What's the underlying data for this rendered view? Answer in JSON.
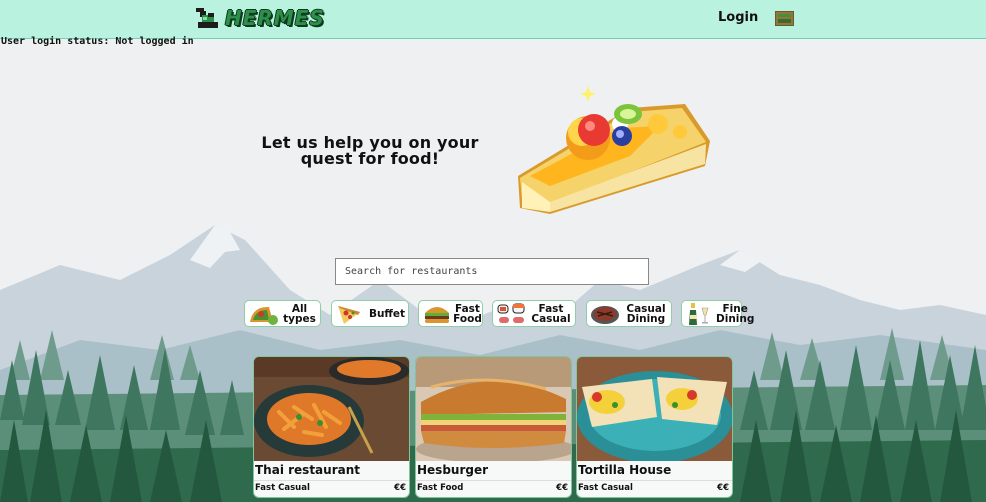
{
  "header": {
    "logo_text": "HERMES",
    "login_label": "Login",
    "profile_icon": "profile-icon"
  },
  "status": {
    "login_status": "User login status: Not logged in"
  },
  "hero": {
    "title": "Let us help you on your quest for food!",
    "image_icon": "fruit-tart-icon"
  },
  "search": {
    "placeholder": "Search for restaurants",
    "value": ""
  },
  "filters": [
    {
      "label": "All\ntypes",
      "icon": "taco-icon"
    },
    {
      "label": "Buffet",
      "icon": "pizza-icon"
    },
    {
      "label": "Fast\nFood",
      "icon": "burger-icon"
    },
    {
      "label": "Fast\nCasual",
      "icon": "sushi-icon"
    },
    {
      "label": "Casual\nDining",
      "icon": "steak-icon"
    },
    {
      "label": "Fine\nDining",
      "icon": "champagne-icon"
    }
  ],
  "restaurants": [
    {
      "name": "Thai restaurant",
      "category": "Fast Casual",
      "price": "€€",
      "image": "pasta-photo"
    },
    {
      "name": "Hesburger",
      "category": "Fast Food",
      "price": "€€",
      "image": "sandwich-photo"
    },
    {
      "name": "Tortilla House",
      "category": "Fast Casual",
      "price": "€€",
      "image": "wrap-photo"
    }
  ],
  "colors": {
    "header_bg": "#b9f3df",
    "accent_green": "#2d8f4a",
    "forest_dark": "#2f6a4c",
    "mountain": "#c7d2dc"
  }
}
